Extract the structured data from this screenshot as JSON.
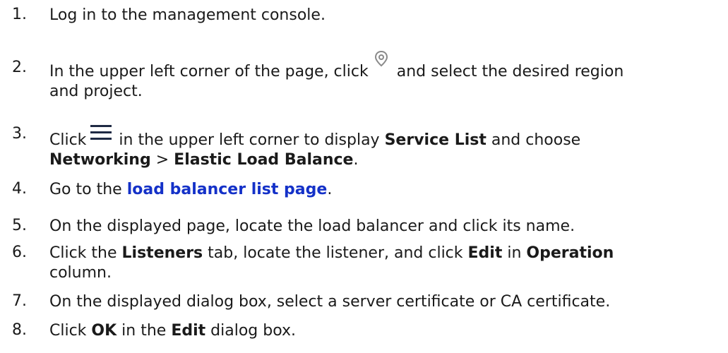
{
  "steps": [
    {
      "num": "1.",
      "parts": [
        "Log in to the management console."
      ]
    },
    {
      "num": "2.",
      "a": "In the upper left corner of the page, click",
      "b": "and select the desired region",
      "c": "and project.",
      "icon": "location-pin-icon"
    },
    {
      "num": "3.",
      "a": "Click",
      "b": "in the upper left corner to display",
      "bold1": "Service List",
      "c": "and choose",
      "bold2": "Networking",
      "sep": ">",
      "bold3": "Elastic Load Balance",
      "end": ".",
      "icon": "hamburger-menu-icon"
    },
    {
      "num": "4.",
      "a": "Go to the",
      "link": "load balancer list page",
      "end": "."
    },
    {
      "num": "5.",
      "a": "On the displayed page, locate the load balancer and click its name."
    },
    {
      "num": "6.",
      "a": "Click the",
      "bold1": "Listeners",
      "b": "tab, locate the listener, and click",
      "bold2": "Edit",
      "c": "in",
      "bold3": "Operation",
      "d": "column."
    },
    {
      "num": "7.",
      "a": "On the displayed dialog box, select a server certificate or CA certificate."
    },
    {
      "num": "8.",
      "a": "Click",
      "bold1": "OK",
      "b": "in the",
      "bold2": "Edit",
      "c": "dialog box."
    }
  ],
  "colors": {
    "text": "#1a1a1a",
    "link": "#1431c8",
    "icon": "#8a8a8a"
  }
}
